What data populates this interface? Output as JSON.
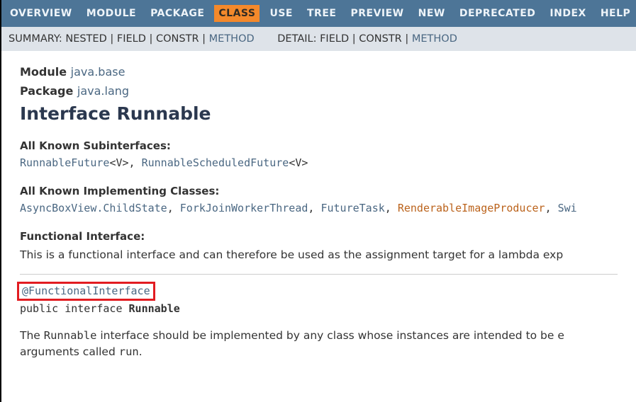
{
  "topnav": {
    "items": [
      {
        "label": "OVERVIEW",
        "active": false
      },
      {
        "label": "MODULE",
        "active": false
      },
      {
        "label": "PACKAGE",
        "active": false
      },
      {
        "label": "CLASS",
        "active": true
      },
      {
        "label": "USE",
        "active": false
      },
      {
        "label": "TREE",
        "active": false
      },
      {
        "label": "PREVIEW",
        "active": false
      },
      {
        "label": "NEW",
        "active": false
      },
      {
        "label": "DEPRECATED",
        "active": false
      },
      {
        "label": "INDEX",
        "active": false
      },
      {
        "label": "HELP",
        "active": false
      }
    ]
  },
  "subnav": {
    "summary_label": "SUMMARY:",
    "summary_items": [
      "NESTED",
      "FIELD",
      "CONSTR"
    ],
    "summary_link": "METHOD",
    "detail_label": "DETAIL:",
    "detail_items": [
      "FIELD",
      "CONSTR"
    ],
    "detail_link": "METHOD"
  },
  "header": {
    "module_label": "Module",
    "module_link": "java.base",
    "package_label": "Package",
    "package_link": "java.lang",
    "title": "Interface Runnable"
  },
  "subinterfaces": {
    "label": "All Known Subinterfaces:",
    "items": [
      {
        "name": "RunnableFuture",
        "suffix": "<V>"
      },
      {
        "name": "RunnableScheduledFuture",
        "suffix": "<V>"
      }
    ]
  },
  "implclasses": {
    "label": "All Known Implementing Classes:",
    "items": [
      {
        "name": "AsyncBoxView.ChildState",
        "orange": false
      },
      {
        "name": "ForkJoinWorkerThread",
        "orange": false
      },
      {
        "name": "FutureTask",
        "orange": false
      },
      {
        "name": "RenderableImageProducer",
        "orange": true
      },
      {
        "name": "Swi",
        "orange": false
      }
    ]
  },
  "functional": {
    "label": "Functional Interface:",
    "text": "This is a functional interface and can therefore be used as the assignment target for a lambda exp"
  },
  "signature": {
    "annotation": "@FunctionalInterface",
    "modifiers": "public interface ",
    "typename": "Runnable"
  },
  "description": {
    "p1a": "The ",
    "p1code": "Runnable",
    "p1b": " interface should be implemented by any class whose instances are intended to be e",
    "p2a": "arguments called ",
    "p2code": "run",
    "p2b": "."
  }
}
